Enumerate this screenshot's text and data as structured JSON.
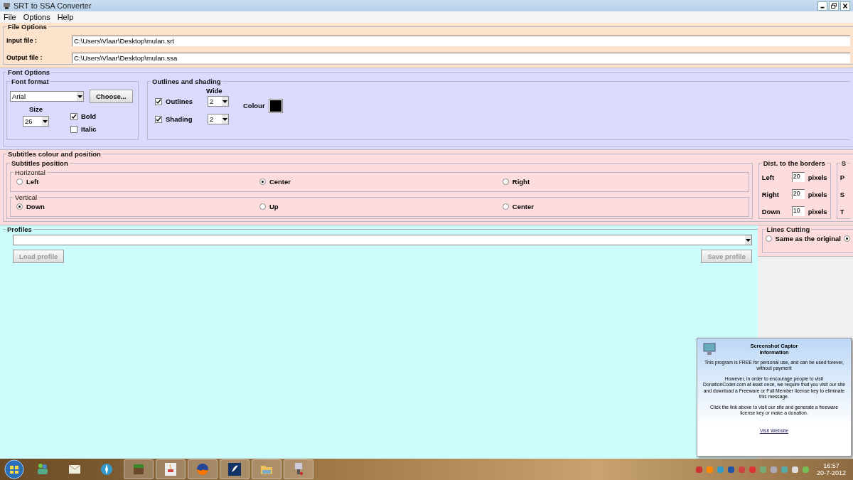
{
  "window": {
    "title": "SRT to SSA Converter"
  },
  "menu": [
    "File",
    "Options",
    "Help"
  ],
  "file_options": {
    "title": "File Options",
    "fields": [
      {
        "label": "Input file :",
        "value": "C:\\Users\\Vlaar\\Desktop\\mulan.srt"
      },
      {
        "label": "Output file :",
        "value": "C:\\Users\\Vlaar\\Desktop\\mulan.ssa"
      }
    ]
  },
  "font_options": {
    "title": "Font Options",
    "font_format": {
      "title": "Font format",
      "font": "Arial",
      "choose_button": "Choose...",
      "size_label": "Size",
      "size": "26",
      "bold": {
        "label": "Bold",
        "checked": true
      },
      "italic": {
        "label": "Italic",
        "checked": false
      }
    },
    "outlines": {
      "title": "Outlines and shading",
      "wide_label": "Wide",
      "rows": [
        {
          "label": "Outlines",
          "checked": true,
          "value": "2"
        },
        {
          "label": "Shading",
          "checked": true,
          "value": "2"
        }
      ],
      "colour_label": "Colour",
      "color": "#000000"
    }
  },
  "subtitles": {
    "title": "Subtitles colour and position",
    "position_title": "Subtitles position",
    "groups": [
      {
        "title": "Horizontal",
        "options": [
          {
            "label": "Left",
            "selected": false
          },
          {
            "label": "Center",
            "selected": true
          },
          {
            "label": "Right",
            "selected": false
          }
        ]
      },
      {
        "title": "Vertical",
        "options": [
          {
            "label": "Down",
            "selected": true
          },
          {
            "label": "Up",
            "selected": false
          },
          {
            "label": "Center",
            "selected": false
          }
        ]
      }
    ],
    "distances": {
      "title": "Dist. to the borders",
      "rows": [
        {
          "label": "Left",
          "value": "20",
          "unit": "pixels"
        },
        {
          "label": "Right",
          "value": "20",
          "unit": "pixels"
        },
        {
          "label": "Down",
          "value": "10",
          "unit": "pixels"
        }
      ]
    },
    "cut_group": {
      "title": "S",
      "labels": [
        "P",
        "S",
        "T"
      ]
    }
  },
  "lines_cutting": {
    "title": "Lines Cutting",
    "options": [
      {
        "label": "Same as the original",
        "selected": false
      },
      {
        "selected": true
      }
    ]
  },
  "profiles": {
    "title": "Profiles",
    "load_button": {
      "label": "Load profile",
      "disabled": true
    },
    "save_button": {
      "label": "Save profile",
      "disabled": true
    }
  },
  "popup": {
    "title": "Screenshot Captor\nInformation",
    "paragraphs": [
      "This program is FREE for personal use, and can be used forever, without payment",
      "However, in order to encourage people to visit DonationCoder.com at least once, we require that you visit our site and download a Freeware or Full Member license key to eliminate this message.",
      "Click the link above to visit our site and generate a freeware license key or make a donation."
    ],
    "link": "Visit Website"
  },
  "taskbar": {
    "apps": [
      {
        "kind": "people",
        "running": false
      },
      {
        "kind": "mail",
        "running": false
      },
      {
        "kind": "compass",
        "running": false
      },
      {
        "kind": "block",
        "running": true
      },
      {
        "kind": "cup",
        "running": true
      },
      {
        "kind": "globe",
        "running": true
      },
      {
        "kind": "bird",
        "running": true
      },
      {
        "kind": "folder",
        "running": true
      },
      {
        "kind": "tool",
        "running": true
      }
    ],
    "time": "16:57",
    "date": "20-7-2012"
  }
}
